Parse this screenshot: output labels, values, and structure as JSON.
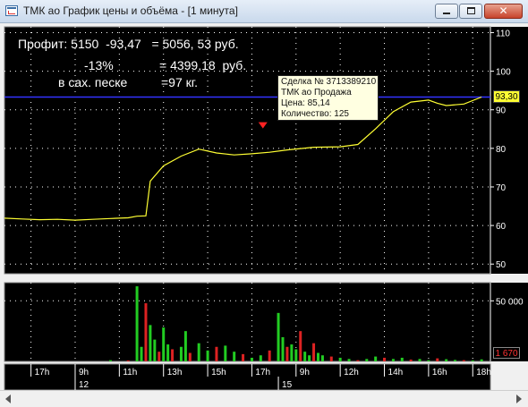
{
  "window": {
    "title": "ТМК ао График цены и объёма - [1 минута]",
    "min_symbol": "▁",
    "close_symbol": "✕"
  },
  "notes": {
    "line1": "Профит: 5150  -93,47   = 5056, 53 руб.",
    "line2": "-13%",
    "line2b": "= 4399,18  руб.",
    "line3": "в сах. песке",
    "line3b": "=97 кг."
  },
  "tooltip": {
    "line1": "Сделка № 3713389210",
    "line2": "ТМК ао Продажа",
    "line3": "Цена: 85,14",
    "line4": "Количество: 125"
  },
  "price_axis": {
    "ticks": [
      "110",
      "100",
      "90",
      "80",
      "70",
      "60",
      "50"
    ],
    "current_price": "93,30",
    "reference_line": 93.3
  },
  "volume_axis": {
    "ticks": [
      "50 000"
    ],
    "current_volume": "1 670"
  },
  "time_axis": {
    "hour_labels": [
      "17h",
      "9h",
      "11h",
      "13h",
      "15h",
      "17h",
      "9h",
      "12h",
      "14h",
      "16h",
      "18h"
    ],
    "day_labels": [
      "12",
      "15"
    ]
  },
  "colors": {
    "background": "#000000",
    "price_line": "#ffff33",
    "reference_line": "#3333ff",
    "volume_green": "#22cc22",
    "volume_red": "#dd2222",
    "grid": "#ffffff",
    "axis_text": "#ffffff",
    "window_bg": "#f0f0f0"
  },
  "chart_data": [
    {
      "type": "line",
      "title": "",
      "series": [
        {
          "x": [
            0,
            4,
            8,
            12,
            16,
            20,
            24,
            28,
            30,
            32,
            33,
            36,
            40,
            44,
            48,
            52,
            56,
            60,
            64,
            70,
            76,
            80,
            84,
            88,
            92,
            96,
            98,
            100,
            104,
            108
          ],
          "y": [
            61.9,
            61.7,
            61.5,
            61.6,
            61.4,
            61.6,
            61.8,
            62.0,
            62.4,
            62.5,
            71.5,
            75.5,
            78.0,
            79.8,
            78.8,
            78.3,
            78.6,
            79.0,
            79.6,
            80.3,
            80.4,
            81.0,
            85.1,
            89.5,
            92.0,
            92.5,
            91.7,
            91.1,
            91.5,
            93.3
          ]
        }
      ],
      "xlabel": "",
      "ylabel": "",
      "ylim": [
        47.5,
        111.5
      ]
    },
    {
      "type": "bar",
      "title": "",
      "note": "volume histogram",
      "series": [
        {
          "x": [
            24,
            28,
            30,
            31,
            32,
            33,
            34,
            35,
            36,
            37,
            38,
            40,
            41,
            42,
            44,
            46,
            48,
            50,
            52,
            54,
            56,
            58,
            60,
            62,
            63,
            64,
            65,
            66,
            67,
            68,
            69,
            70,
            71,
            72,
            74,
            76,
            78,
            80,
            82,
            84,
            86,
            88,
            90,
            92,
            94,
            96,
            98,
            100,
            102,
            104,
            106,
            108
          ],
          "y": [
            1000,
            800,
            62000,
            12000,
            48000,
            30000,
            18000,
            8000,
            28000,
            14000,
            10000,
            12000,
            25000,
            7000,
            15000,
            9000,
            12000,
            13000,
            8000,
            6000,
            3000,
            5000,
            9000,
            40000,
            20000,
            12000,
            14000,
            10000,
            25000,
            8000,
            5000,
            15000,
            7000,
            5000,
            4000,
            3000,
            2000,
            1000,
            2000,
            4000,
            3000,
            2000,
            3000,
            1500,
            2000,
            1000,
            2500,
            1800,
            1200,
            1000,
            800,
            1670
          ]
        }
      ],
      "ylim": [
        0,
        65000
      ]
    }
  ]
}
